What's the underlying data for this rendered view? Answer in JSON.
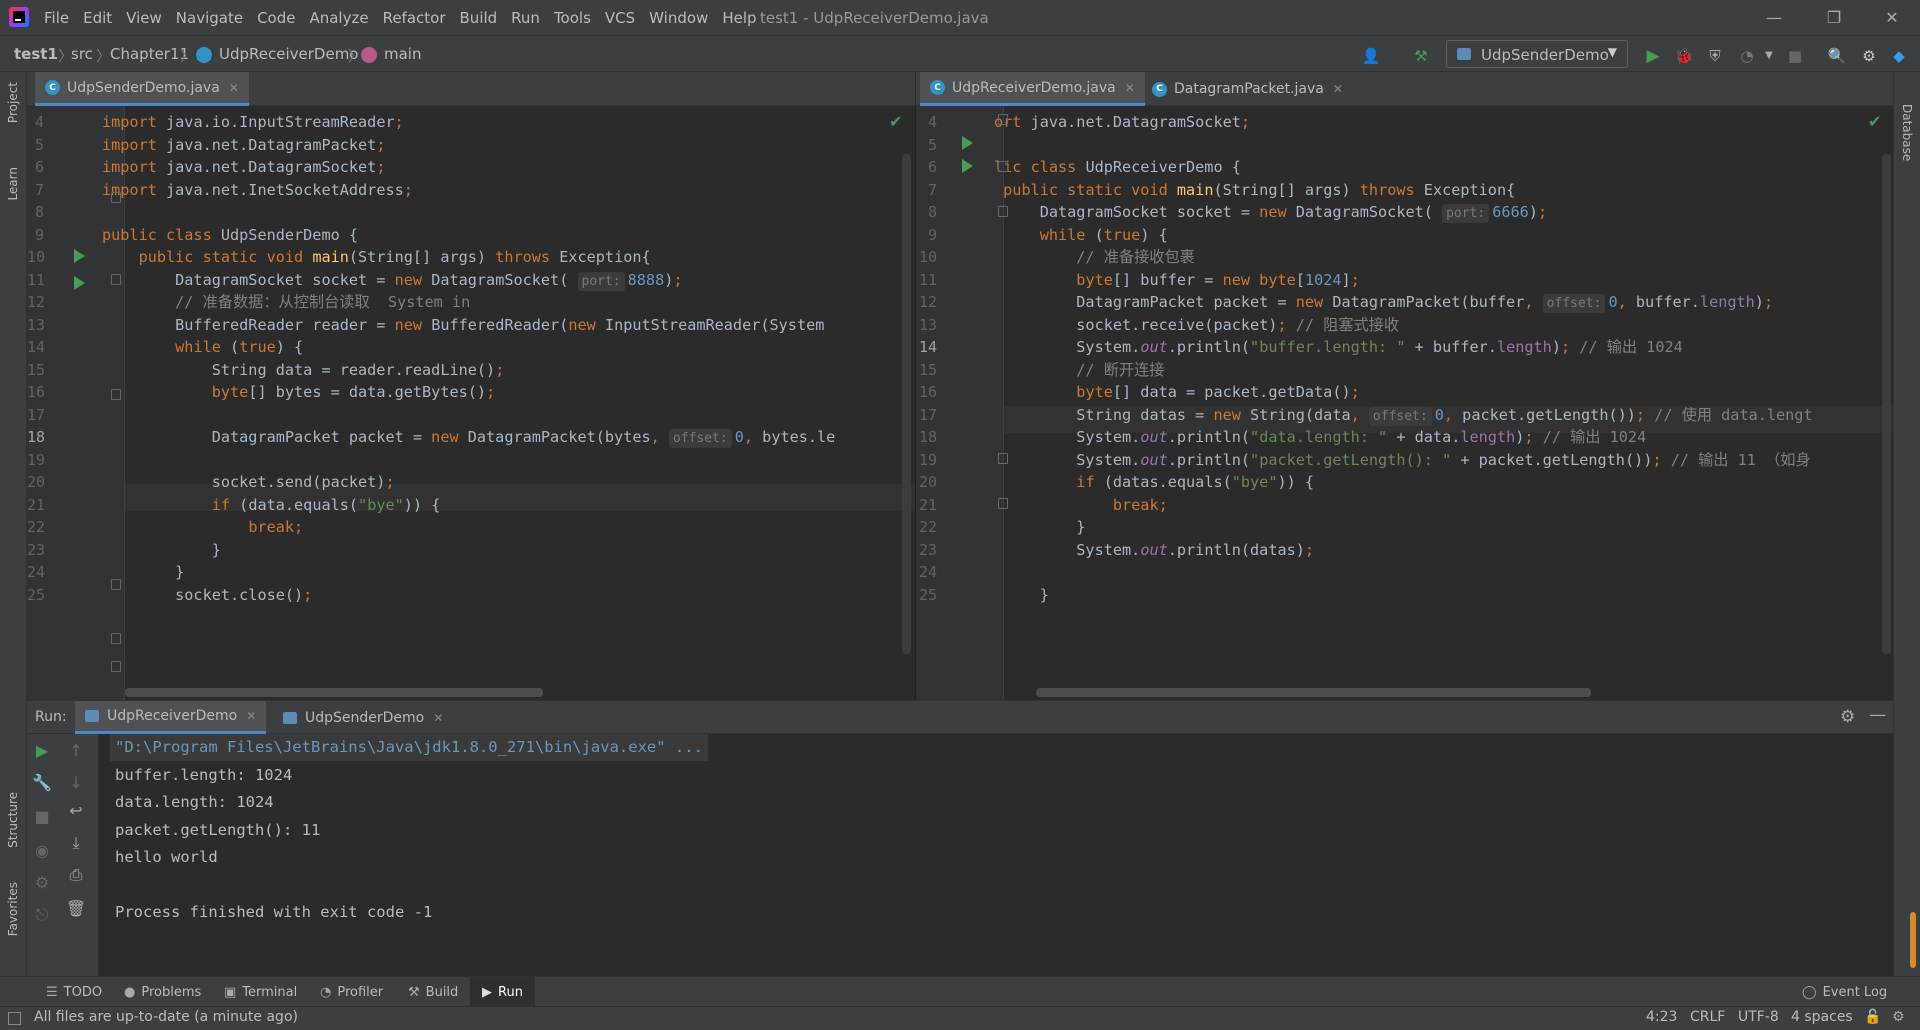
{
  "window": {
    "title": "test1 - UdpReceiverDemo.java",
    "minimize": "—",
    "restore": "❐",
    "close": "✕"
  },
  "menu": [
    "File",
    "Edit",
    "View",
    "Navigate",
    "Code",
    "Analyze",
    "Refactor",
    "Build",
    "Run",
    "Tools",
    "VCS",
    "Window",
    "Help"
  ],
  "breadcrumbs": [
    "test1",
    "src",
    "Chapter11",
    "UdpReceiverDemo",
    "main"
  ],
  "run_config": {
    "label": "UdpSenderDemo"
  },
  "left_strip": [
    "Project",
    "Learn",
    "Structure",
    "Favorites"
  ],
  "right_strip": [
    "Database"
  ],
  "left_editor": {
    "tabs": [
      {
        "label": "UdpSenderDemo.java",
        "active": true
      }
    ],
    "lines": [
      {
        "n": "4",
        "parts": [
          [
            "kw",
            "import "
          ],
          [
            "tx",
            "java.io.InputStreamReader"
          ],
          [
            "kw",
            ";"
          ]
        ]
      },
      {
        "n": "5",
        "parts": [
          [
            "kw",
            "import "
          ],
          [
            "tx",
            "java.net.DatagramPacket"
          ],
          [
            "kw",
            ";"
          ]
        ]
      },
      {
        "n": "6",
        "parts": [
          [
            "kw",
            "import "
          ],
          [
            "tx",
            "java.net.DatagramSocket"
          ],
          [
            "kw",
            ";"
          ]
        ]
      },
      {
        "n": "7",
        "parts": [
          [
            "kw",
            "import "
          ],
          [
            "tx",
            "java.net.InetSocketAddress"
          ],
          [
            "kw",
            ";"
          ]
        ]
      },
      {
        "n": "8",
        "parts": []
      },
      {
        "n": "9",
        "parts": [
          [
            "kw",
            "public class "
          ],
          [
            "tx",
            "UdpSenderDemo {"
          ]
        ]
      },
      {
        "n": "10",
        "parts": [
          [
            "tx",
            "    "
          ],
          [
            "kw",
            "public static void "
          ],
          [
            "fn",
            "main"
          ],
          [
            "tx",
            "(String[] args) "
          ],
          [
            "kw",
            "throws "
          ],
          [
            "tx",
            "Exception{"
          ]
        ]
      },
      {
        "n": "11",
        "parts": [
          [
            "tx",
            "        DatagramSocket socket = "
          ],
          [
            "kw",
            "new "
          ],
          [
            "tx",
            "DatagramSocket( "
          ],
          [
            "hint",
            "port:"
          ],
          [
            "num",
            "8888"
          ],
          [
            "tx",
            ")"
          ],
          [
            "kw",
            ";"
          ]
        ]
      },
      {
        "n": "12",
        "parts": [
          [
            "cm",
            "        // 准备数据：从控制台读取  System in"
          ]
        ]
      },
      {
        "n": "13",
        "parts": [
          [
            "tx",
            "        BufferedReader reader = "
          ],
          [
            "kw",
            "new "
          ],
          [
            "tx",
            "BufferedReader("
          ],
          [
            "kw",
            "new "
          ],
          [
            "tx",
            "InputStreamReader(System"
          ]
        ]
      },
      {
        "n": "14",
        "parts": [
          [
            "tx",
            "        "
          ],
          [
            "kw",
            "while "
          ],
          [
            "tx",
            "("
          ],
          [
            "kw",
            "true"
          ],
          [
            "tx",
            ") {"
          ]
        ]
      },
      {
        "n": "15",
        "parts": [
          [
            "tx",
            "            String data = reader.readLine()"
          ],
          [
            "kw",
            ";"
          ]
        ]
      },
      {
        "n": "16",
        "parts": [
          [
            "tx",
            "            "
          ],
          [
            "kw",
            "byte"
          ],
          [
            "tx",
            "[] bytes = data.getBytes()"
          ],
          [
            "kw",
            ";"
          ]
        ]
      },
      {
        "n": "17",
        "parts": []
      },
      {
        "n": "18",
        "parts": [
          [
            "tx",
            "            DatagramPacket packet = "
          ],
          [
            "kw",
            "new "
          ],
          [
            "tx",
            "DatagramPacket(bytes"
          ],
          [
            "kw",
            ", "
          ],
          [
            "hint",
            "offset:"
          ],
          [
            "num",
            "0"
          ],
          [
            "kw",
            ", "
          ],
          [
            "tx",
            "bytes.le"
          ]
        ]
      },
      {
        "n": "19",
        "parts": []
      },
      {
        "n": "20",
        "parts": [
          [
            "tx",
            "            socket.send(packet)"
          ],
          [
            "kw",
            ";"
          ]
        ]
      },
      {
        "n": "21",
        "parts": [
          [
            "tx",
            "            "
          ],
          [
            "kw",
            "if "
          ],
          [
            "tx",
            "(data.equals("
          ],
          [
            "str",
            "\"bye\""
          ],
          [
            "tx",
            ")) {"
          ]
        ]
      },
      {
        "n": "22",
        "parts": [
          [
            "tx",
            "                "
          ],
          [
            "kw",
            "break;"
          ]
        ]
      },
      {
        "n": "23",
        "parts": [
          [
            "tx",
            "            }"
          ]
        ]
      },
      {
        "n": "24",
        "parts": [
          [
            "tx",
            "        }"
          ]
        ]
      },
      {
        "n": "25",
        "parts": [
          [
            "tx",
            "        socket.close()"
          ],
          [
            "kw",
            ";"
          ]
        ]
      }
    ]
  },
  "right_editor": {
    "tabs": [
      {
        "label": "UdpReceiverDemo.java",
        "active": true
      },
      {
        "label": "DatagramPacket.java",
        "active": false
      }
    ],
    "lines": [
      {
        "n": "4",
        "parts": [
          [
            "kw",
            "ort "
          ],
          [
            "tx",
            "java.net.DatagramSocket"
          ],
          [
            "kw",
            ";"
          ]
        ]
      },
      {
        "n": "5",
        "parts": []
      },
      {
        "n": "6",
        "parts": [
          [
            "kw",
            "lic class "
          ],
          [
            "tx",
            "UdpReceiverDemo {"
          ]
        ]
      },
      {
        "n": "7",
        "parts": [
          [
            "tx",
            " "
          ],
          [
            "kw",
            "public static void "
          ],
          [
            "fn",
            "main"
          ],
          [
            "tx",
            "(String[] args) "
          ],
          [
            "kw",
            "throws "
          ],
          [
            "tx",
            "Exception{"
          ]
        ]
      },
      {
        "n": "8",
        "parts": [
          [
            "tx",
            "     DatagramSocket socket = "
          ],
          [
            "kw",
            "new "
          ],
          [
            "tx",
            "DatagramSocket( "
          ],
          [
            "hint",
            "port:"
          ],
          [
            "num",
            "6666"
          ],
          [
            "tx",
            ")"
          ],
          [
            "kw",
            ";"
          ]
        ]
      },
      {
        "n": "9",
        "parts": [
          [
            "tx",
            "     "
          ],
          [
            "kw",
            "while "
          ],
          [
            "tx",
            "("
          ],
          [
            "kw",
            "true"
          ],
          [
            "tx",
            ") {"
          ]
        ]
      },
      {
        "n": "10",
        "parts": [
          [
            "cm",
            "         // 准备接收包裹"
          ]
        ]
      },
      {
        "n": "11",
        "parts": [
          [
            "tx",
            "         "
          ],
          [
            "kw",
            "byte"
          ],
          [
            "tx",
            "[] buffer = "
          ],
          [
            "kw",
            "new byte"
          ],
          [
            "tx",
            "["
          ],
          [
            "num",
            "1024"
          ],
          [
            "tx",
            "]"
          ],
          [
            "kw",
            ";"
          ]
        ]
      },
      {
        "n": "12",
        "parts": [
          [
            "tx",
            "         DatagramPacket packet = "
          ],
          [
            "kw",
            "new "
          ],
          [
            "tx",
            "DatagramPacket(buffer"
          ],
          [
            "kw",
            ", "
          ],
          [
            "hint",
            "offset:"
          ],
          [
            "num",
            "0"
          ],
          [
            "kw",
            ", "
          ],
          [
            "tx",
            "buffer."
          ],
          [
            "fld",
            "length"
          ],
          [
            "tx",
            ")"
          ],
          [
            "kw",
            ";"
          ]
        ]
      },
      {
        "n": "13",
        "parts": [
          [
            "tx",
            "         socket.receive(packet)"
          ],
          [
            "kw",
            "; "
          ],
          [
            "cm",
            "// 阻塞式接收"
          ]
        ]
      },
      {
        "n": "14",
        "parts": [
          [
            "tx",
            "         System."
          ],
          [
            "st",
            "out"
          ],
          [
            "tx",
            ".println("
          ],
          [
            "str",
            "\"buffer.length: \""
          ],
          [
            "tx",
            " + buffer."
          ],
          [
            "fld",
            "length"
          ],
          [
            "tx",
            ")"
          ],
          [
            "kw",
            "; "
          ],
          [
            "cm",
            "// 输出 1024"
          ]
        ]
      },
      {
        "n": "15",
        "parts": [
          [
            "cm",
            "         // 断开连接"
          ]
        ]
      },
      {
        "n": "16",
        "parts": [
          [
            "tx",
            "         "
          ],
          [
            "kw",
            "byte"
          ],
          [
            "tx",
            "[] data = packet.getData()"
          ],
          [
            "kw",
            ";"
          ]
        ]
      },
      {
        "n": "17",
        "parts": [
          [
            "tx",
            "         String datas = "
          ],
          [
            "kw",
            "new "
          ],
          [
            "tx",
            "String(data"
          ],
          [
            "kw",
            ", "
          ],
          [
            "hint",
            "offset:"
          ],
          [
            "num",
            "0"
          ],
          [
            "kw",
            ", "
          ],
          [
            "tx",
            "packet.getLength())"
          ],
          [
            "kw",
            "; "
          ],
          [
            "cm",
            "// 使用 data.lengt"
          ]
        ]
      },
      {
        "n": "18",
        "parts": [
          [
            "tx",
            "         System."
          ],
          [
            "st",
            "out"
          ],
          [
            "tx",
            ".println("
          ],
          [
            "str",
            "\"data.length: \""
          ],
          [
            "tx",
            " + data."
          ],
          [
            "fld",
            "length"
          ],
          [
            "tx",
            ")"
          ],
          [
            "kw",
            "; "
          ],
          [
            "cm",
            "// 输出 1024"
          ]
        ]
      },
      {
        "n": "19",
        "parts": [
          [
            "tx",
            "         System."
          ],
          [
            "st",
            "out"
          ],
          [
            "tx",
            ".println("
          ],
          [
            "str",
            "\"packet.getLength(): \""
          ],
          [
            "tx",
            " + packet.getLength())"
          ],
          [
            "kw",
            "; "
          ],
          [
            "cm",
            "// 输出 11 （如身"
          ]
        ]
      },
      {
        "n": "20",
        "parts": [
          [
            "tx",
            "         "
          ],
          [
            "kw",
            "if "
          ],
          [
            "tx",
            "(datas.equals("
          ],
          [
            "str",
            "\"bye\""
          ],
          [
            "tx",
            ")) {"
          ]
        ]
      },
      {
        "n": "21",
        "parts": [
          [
            "tx",
            "             "
          ],
          [
            "kw",
            "break;"
          ]
        ]
      },
      {
        "n": "22",
        "parts": [
          [
            "tx",
            "         }"
          ]
        ]
      },
      {
        "n": "23",
        "parts": [
          [
            "tx",
            "         System."
          ],
          [
            "st",
            "out"
          ],
          [
            "tx",
            ".println(datas)"
          ],
          [
            "kw",
            ";"
          ]
        ]
      },
      {
        "n": "24",
        "parts": []
      },
      {
        "n": "25",
        "parts": [
          [
            "tx",
            "     }"
          ]
        ]
      }
    ]
  },
  "run_panel": {
    "label": "Run:",
    "tabs": [
      {
        "label": "UdpReceiverDemo",
        "active": true
      },
      {
        "label": "UdpSenderDemo",
        "active": false
      }
    ],
    "console": [
      "\"D:\\Program Files\\JetBrains\\Java\\jdk1.8.0_271\\bin\\java.exe\" ...",
      "buffer.length: 1024",
      "data.length: 1024",
      "packet.getLength(): 11",
      "hello world",
      "",
      "Process finished with exit code -1"
    ]
  },
  "tool_windows": [
    "TODO",
    "Problems",
    "Terminal",
    "Profiler",
    "Build",
    "Run"
  ],
  "event_log": "Event Log",
  "status": {
    "message": "All files are up-to-date (a minute ago)",
    "position": "4:23",
    "line_sep": "CRLF",
    "encoding": "UTF-8",
    "indent": "4 spaces"
  },
  "colors": {
    "accent": "#4a88c7",
    "run_green": "#499c54",
    "bg": "#2b2b2b",
    "panel": "#3c3f41"
  }
}
